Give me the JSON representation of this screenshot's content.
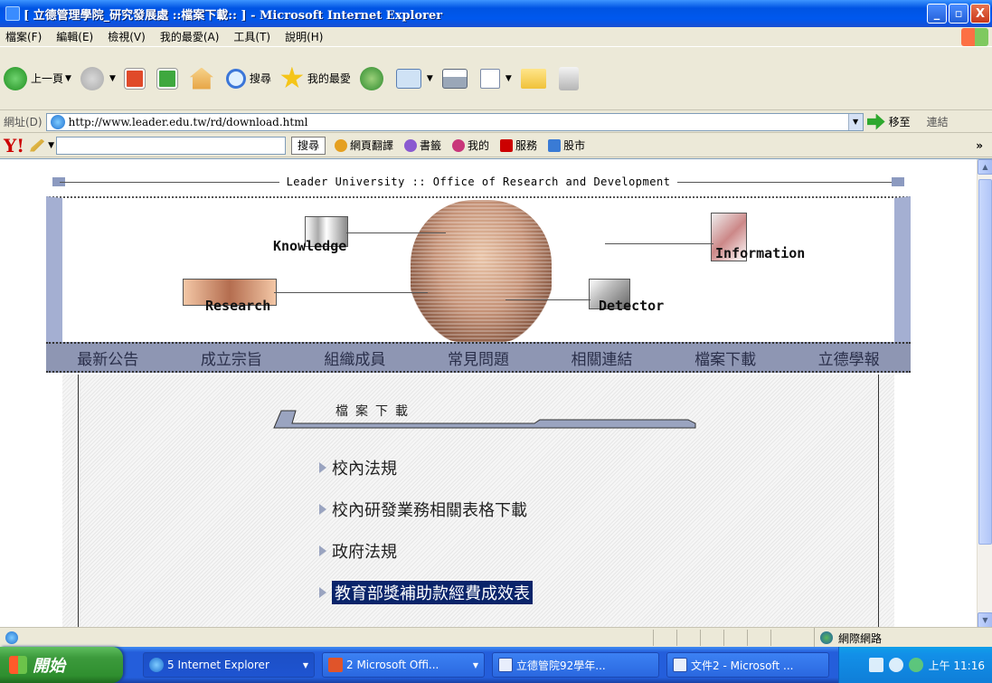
{
  "window": {
    "title": "[ 立德管理學院_研究發展處 ::檔案下載:: ] - Microsoft Internet Explorer",
    "minimize": "_",
    "maximize": "▫",
    "close": "X"
  },
  "menu": [
    "檔案(F)",
    "編輯(E)",
    "檢視(V)",
    "我的最愛(A)",
    "工具(T)",
    "說明(H)"
  ],
  "toolbar": {
    "back_label": "上一頁",
    "search_label": "搜尋",
    "favorites_label": "我的最愛"
  },
  "address": {
    "label": "網址(D)",
    "url": "http://www.leader.edu.tw/rd/download.html",
    "go_label": "移至",
    "links_label": "連結"
  },
  "yahoo": {
    "logo": "Y!",
    "search_button": "搜尋",
    "translate": "網頁翻譯",
    "bookmarks": "書籤",
    "my": "我的",
    "services": "服務",
    "stocks": "股市",
    "more": "»"
  },
  "site": {
    "header_text": "Leader University :: Office of Research and Development",
    "banner_labels": {
      "knowledge": "Knowledge",
      "information": "Information",
      "research": "Research",
      "detector": "Detector"
    },
    "nav": [
      "最新公告",
      "成立宗旨",
      "組織成員",
      "常見問題",
      "相關連結",
      "檔案下載",
      "立德學報"
    ],
    "section_title": "檔案下載",
    "files": [
      {
        "label": "校內法規",
        "selected": false
      },
      {
        "label": "校內研發業務相關表格下載",
        "selected": false
      },
      {
        "label": "政府法規",
        "selected": false
      },
      {
        "label": "教育部獎補助款經費成效表",
        "selected": true
      }
    ]
  },
  "status": {
    "zone": "網際網路"
  },
  "taskbar": {
    "start": "開始",
    "tasks": [
      {
        "label": "5 Internet Explorer",
        "active": true
      },
      {
        "label": "2 Microsoft Offi...",
        "active": false
      },
      {
        "label": "立德管院92學年...",
        "active": false
      },
      {
        "label": "文件2 - Microsoft ...",
        "active": false
      }
    ],
    "clock": "上午 11:16"
  }
}
